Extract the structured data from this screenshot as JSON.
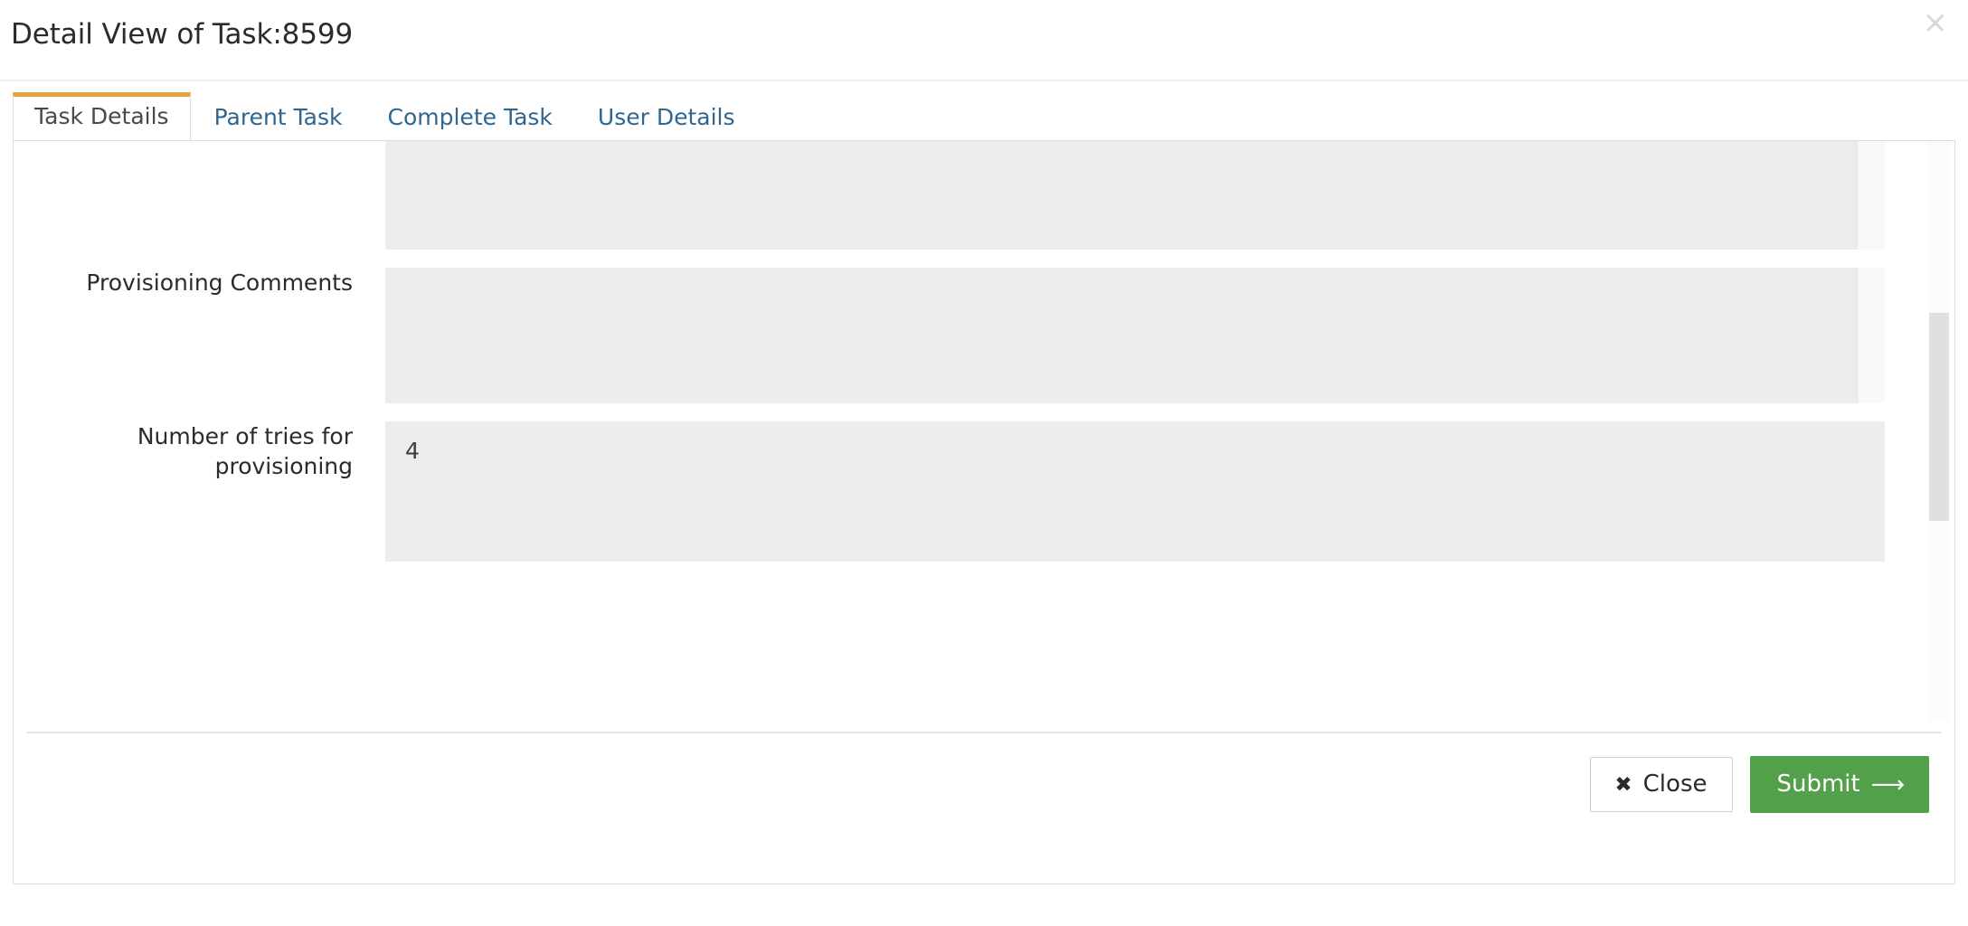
{
  "header": {
    "title": "Detail View of Task:8599",
    "close_icon": "close-x-icon",
    "close_glyph": "×"
  },
  "tabs": [
    {
      "label": "Task Details",
      "active": true
    },
    {
      "label": "Parent Task",
      "active": false
    },
    {
      "label": "Complete Task",
      "active": false
    },
    {
      "label": "User Details",
      "active": false
    }
  ],
  "form": {
    "fields": [
      {
        "label": "",
        "value": "",
        "kind": "textarea-partial"
      },
      {
        "label": "Provisioning Comments",
        "value": "",
        "kind": "textarea"
      },
      {
        "label": "Number of tries for provisioning",
        "value": "4",
        "kind": "textarea"
      }
    ]
  },
  "footer": {
    "close_label": "Close",
    "close_icon_glyph": "✖",
    "submit_label": "Submit",
    "submit_icon_glyph": "⟶"
  },
  "colors": {
    "active_tab_accent": "#e8a33d",
    "tab_link": "#2f6690",
    "submit_green": "#52a04a",
    "field_background": "#ececec",
    "panel_border": "#dddddd"
  }
}
